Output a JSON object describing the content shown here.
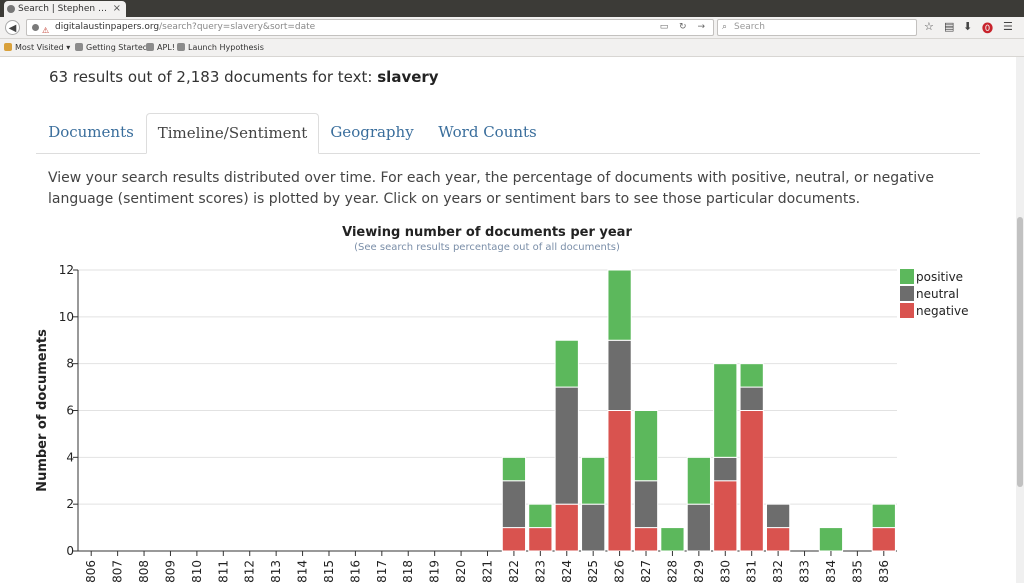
{
  "browser": {
    "tab_title": "Search | Stephen F. ...",
    "tab_close": "×",
    "url_host": "digitalaustinpapers.org",
    "url_path": "/search?query=slavery&sort=date",
    "search_placeholder": "Search",
    "bookmarks": [
      "Most Visited ▾",
      "Getting Started",
      "APL!",
      "Launch Hypothesis"
    ]
  },
  "page": {
    "results_prefix": "63 results out of 2,183 documents for text:",
    "query": "slavery",
    "tabs": [
      "Documents",
      "Timeline/Sentiment",
      "Geography",
      "Word Counts"
    ],
    "active_tab": "Timeline/Sentiment",
    "description": "View your search results distributed over time. For each year, the percentage of documents with positive, neutral, or negative language (sentiment scores) is plotted by year. Click on years or sentiment bars to see those particular documents."
  },
  "chart_data": {
    "type": "bar",
    "stacked": true,
    "title": "Viewing number of documents per year",
    "subtitle": "(See search results percentage out of all documents)",
    "xlabel": "",
    "ylabel": "Number of documents",
    "ylim": [
      0,
      12
    ],
    "yticks": [
      0,
      2,
      4,
      6,
      8,
      10,
      12
    ],
    "grid": true,
    "legend_position": "top-right",
    "categories": [
      "1806",
      "1807",
      "1808",
      "1809",
      "1810",
      "1811",
      "1812",
      "1813",
      "1814",
      "1815",
      "1816",
      "1817",
      "1818",
      "1819",
      "1820",
      "1821",
      "1822",
      "1823",
      "1824",
      "1825",
      "1826",
      "1827",
      "1828",
      "1829",
      "1830",
      "1831",
      "1832",
      "1833",
      "1834",
      "1835",
      "1836"
    ],
    "series": [
      {
        "name": "negative",
        "color": "#d9534f",
        "values": [
          0,
          0,
          0,
          0,
          0,
          0,
          0,
          0,
          0,
          0,
          0,
          0,
          0,
          0,
          0,
          0,
          1,
          1,
          2,
          0,
          6,
          1,
          0,
          0,
          3,
          6,
          1,
          0,
          0,
          0,
          1
        ]
      },
      {
        "name": "neutral",
        "color": "#6d6d6d",
        "values": [
          0,
          0,
          0,
          0,
          0,
          0,
          0,
          0,
          0,
          0,
          0,
          0,
          0,
          0,
          0,
          0,
          2,
          0,
          5,
          2,
          3,
          2,
          0,
          2,
          1,
          1,
          1,
          0,
          0,
          0,
          0
        ]
      },
      {
        "name": "positive",
        "color": "#5cb85c",
        "values": [
          0,
          0,
          0,
          0,
          0,
          0,
          0,
          0,
          0,
          0,
          0,
          0,
          0,
          0,
          0,
          0,
          1,
          1,
          2,
          2,
          3,
          3,
          1,
          2,
          4,
          1,
          0,
          0,
          1,
          0,
          1
        ]
      }
    ],
    "legend_order": [
      "positive",
      "neutral",
      "negative"
    ]
  }
}
